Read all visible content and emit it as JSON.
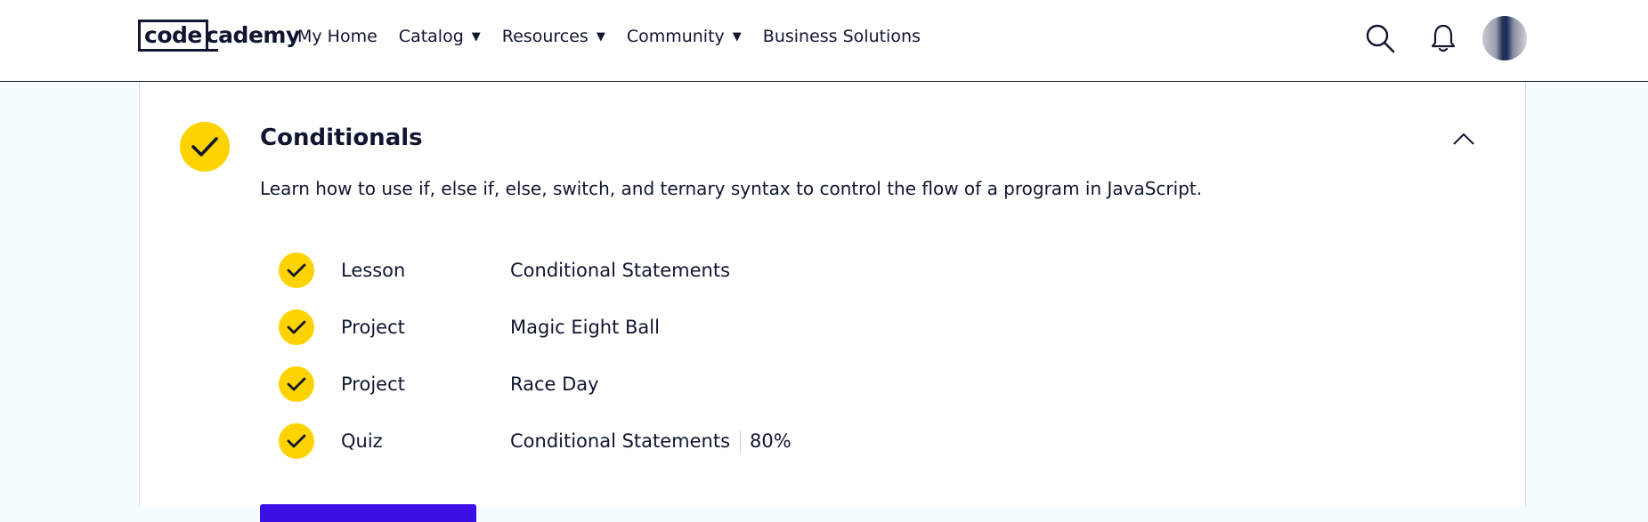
{
  "header": {
    "logo": {
      "boxed": "code",
      "rest": "cademy"
    },
    "nav": [
      {
        "label": "My Home",
        "dropdown": false
      },
      {
        "label": "Catalog",
        "dropdown": true
      },
      {
        "label": "Resources",
        "dropdown": true
      },
      {
        "label": "Community",
        "dropdown": true
      },
      {
        "label": "Business Solutions",
        "dropdown": false
      }
    ],
    "caret": "▼",
    "icons": [
      "search-icon",
      "bell-icon",
      "avatar"
    ]
  },
  "section": {
    "title": "Conditionals",
    "description": "Learn how to use if, else if, else, switch, and ternary syntax to control the flow of a program in JavaScript.",
    "completed": true,
    "expanded": true,
    "items": [
      {
        "type": "Lesson",
        "name": "Conditional Statements",
        "score": ""
      },
      {
        "type": "Project",
        "name": "Magic Eight Ball",
        "score": ""
      },
      {
        "type": "Project",
        "name": "Race Day",
        "score": ""
      },
      {
        "type": "Quiz",
        "name": "Conditional Statements",
        "score": "80%"
      }
    ]
  },
  "colors": {
    "accent_yellow": "#ffd300",
    "navy": "#10162f",
    "cta_purple": "#3a10e5",
    "page_bg": "#f5fcff"
  }
}
